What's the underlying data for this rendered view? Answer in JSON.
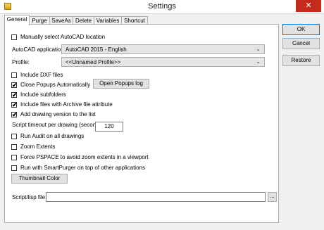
{
  "window": {
    "title": "Settings",
    "close_glyph": "✕",
    "icon": "settings-app-icon"
  },
  "tabs": [
    {
      "label": "General"
    },
    {
      "label": "Purge"
    },
    {
      "label": "SaveAs"
    },
    {
      "label": "Delete"
    },
    {
      "label": "Variables"
    },
    {
      "label": "Shortcut"
    }
  ],
  "general": {
    "manual_location": {
      "label": "Manually select AutoCAD location",
      "checked": false
    },
    "autocad_app": {
      "label": "AutoCAD application:",
      "value": "AutoCAD 2015 - English"
    },
    "profile": {
      "label": "Profile:",
      "value": "<<Unnamed Profile>>"
    },
    "include_dxf": {
      "label": "Include DXF files",
      "checked": false
    },
    "close_popups": {
      "label": "Close Popups Automatically",
      "checked": true
    },
    "open_popups_log": "Open Popups log",
    "include_subfolders": {
      "label": "Include subfolders",
      "checked": true
    },
    "include_archive": {
      "label": "Include files with Archive file attribute",
      "checked": true
    },
    "add_drawing_version": {
      "label": "Add drawing version to the list",
      "checked": true
    },
    "script_timeout": {
      "label": "Script timeout per drawing (seconds):",
      "value": "120"
    },
    "run_audit": {
      "label": "Run Audit on all drawings",
      "checked": false
    },
    "zoom_extents": {
      "label": "Zoom Extents",
      "checked": false
    },
    "force_pspace": {
      "label": "Force PSPACE to avoid zoom extents in a viewport",
      "checked": false
    },
    "run_on_top": {
      "label": "Run with SmartPurger on top of other applications",
      "checked": false
    },
    "thumbnail_color": "Thumbnail Color",
    "script_file": {
      "label": "Script/lisp file:",
      "value": "",
      "browse": "..."
    }
  },
  "buttons": {
    "ok": "OK",
    "cancel": "Cancel",
    "restore": "Restore"
  },
  "check_glyph": "✔"
}
